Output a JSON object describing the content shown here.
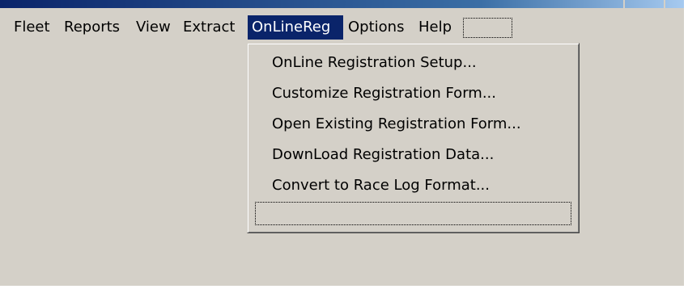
{
  "menubar": {
    "items": [
      {
        "label": "Fleet"
      },
      {
        "label": "Reports"
      },
      {
        "label": "View"
      },
      {
        "label": "Extract"
      },
      {
        "label": "OnLineReg"
      },
      {
        "label": "Options"
      },
      {
        "label": "Help"
      }
    ],
    "active_item": "OnLineReg"
  },
  "dropdown": {
    "items": [
      {
        "label": "OnLine Registration Setup..."
      },
      {
        "label": "Customize Registration Form..."
      },
      {
        "label": "Open Existing Registration Form..."
      },
      {
        "label": "DownLoad Registration Data..."
      },
      {
        "label": "Convert to Race Log Format..."
      }
    ]
  },
  "colors": {
    "menu_highlight": "#0a246a",
    "window_face": "#d4d0c8"
  }
}
